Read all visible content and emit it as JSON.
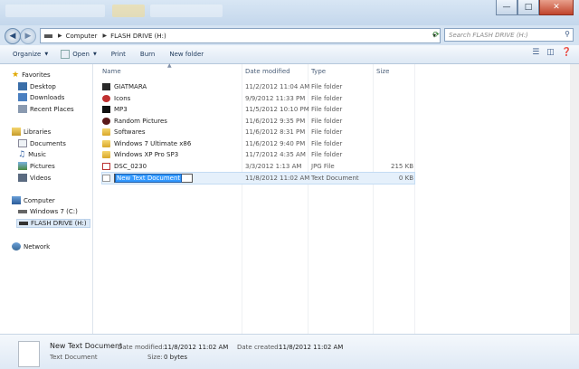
{
  "address": {
    "crumbs": [
      "Computer",
      "FLASH DRIVE (H:)"
    ]
  },
  "search": {
    "placeholder": "Search FLASH DRIVE (H:)"
  },
  "toolbar": {
    "organize": "Organize",
    "open": "Open",
    "print": "Print",
    "burn": "Burn",
    "new_folder": "New folder"
  },
  "nav": {
    "favorites": "Favorites",
    "desktop": "Desktop",
    "downloads": "Downloads",
    "recent": "Recent Places",
    "libraries": "Libraries",
    "documents": "Documents",
    "music": "Music",
    "pictures": "Pictures",
    "videos": "Videos",
    "computer": "Computer",
    "win7": "Windows 7 (C:)",
    "flash": "FLASH DRIVE (H:)",
    "network": "Network"
  },
  "columns": {
    "name": "Name",
    "date": "Date modified",
    "type": "Type",
    "size": "Size"
  },
  "files": [
    {
      "name": "GIATMARA",
      "date": "11/2/2012 11:04 AM",
      "type": "File folder",
      "size": ""
    },
    {
      "name": "Icons",
      "date": "9/9/2012 11:33 PM",
      "type": "File folder",
      "size": ""
    },
    {
      "name": "MP3",
      "date": "11/5/2012 10:10 PM",
      "type": "File folder",
      "size": ""
    },
    {
      "name": "Random Pictures",
      "date": "11/6/2012 9:35 PM",
      "type": "File folder",
      "size": ""
    },
    {
      "name": "Softwares",
      "date": "11/6/2012 8:31 PM",
      "type": "File folder",
      "size": ""
    },
    {
      "name": "Windows 7 Ultimate x86",
      "date": "11/6/2012 9:40 PM",
      "type": "File folder",
      "size": ""
    },
    {
      "name": "Windows XP Pro SP3",
      "date": "11/7/2012 4:35 AM",
      "type": "File folder",
      "size": ""
    },
    {
      "name": "DSC_0230",
      "date": "3/3/2012 1:13 AM",
      "type": "JPG File",
      "size": "215 KB"
    },
    {
      "name": "New Text Document",
      "date": "11/8/2012 11:02 AM",
      "type": "Text Document",
      "size": "0 KB"
    }
  ],
  "details": {
    "name": "New Text Document",
    "type": "Text Document",
    "modified_label": "Date modified:",
    "modified": "11/8/2012 11:02 AM",
    "created_label": "Date created:",
    "created": "11/8/2012 11:02 AM",
    "size_label": "Size:",
    "size": "0 bytes"
  }
}
